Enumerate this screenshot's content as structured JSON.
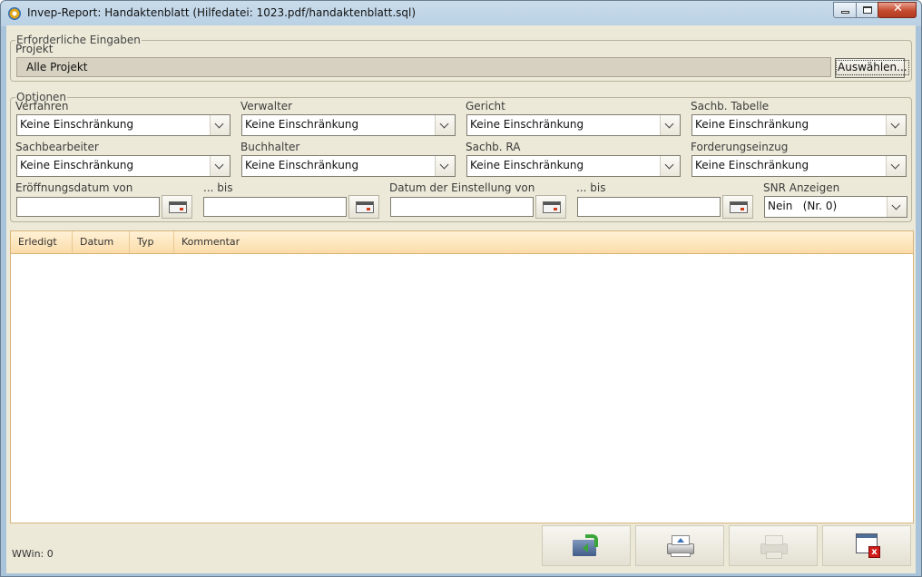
{
  "window": {
    "title": "Invep-Report: Handaktenblatt   (Hilfedatei: 1023.pdf/handaktenblatt.sql)"
  },
  "required": {
    "legend": "Erforderliche Eingaben",
    "projekt_label": "Projekt",
    "projekt_value": "Alle Projekt",
    "select_button": "Auswählen..."
  },
  "options": {
    "legend": "Optionen",
    "combos": [
      {
        "label": "Verfahren",
        "value": "Keine Einschränkung"
      },
      {
        "label": "Verwalter",
        "value": "Keine Einschränkung"
      },
      {
        "label": "Gericht",
        "value": "Keine Einschränkung"
      },
      {
        "label": "Sachb. Tabelle",
        "value": "Keine Einschränkung"
      },
      {
        "label": "Sachbearbeiter",
        "value": "Keine Einschränkung"
      },
      {
        "label": "Buchhalter",
        "value": "Keine Einschränkung"
      },
      {
        "label": "Sachb. RA",
        "value": "Keine Einschränkung"
      },
      {
        "label": "Forderungseinzug",
        "value": "Keine Einschränkung"
      }
    ],
    "dates": [
      {
        "label": "Eröffnungsdatum von",
        "value": ""
      },
      {
        "label": "... bis",
        "value": ""
      },
      {
        "label": "Datum der Einstellung von",
        "value": ""
      },
      {
        "label": "... bis",
        "value": ""
      }
    ],
    "snr": {
      "label": "SNR Anzeigen",
      "value": "Nein   (Nr. 0)"
    }
  },
  "table": {
    "columns": [
      "Erledigt",
      "Datum",
      "Typ",
      "Kommentar"
    ],
    "rows": []
  },
  "status": "WWin: 0",
  "toolbar": {
    "icons": [
      "folder-export-icon",
      "printer-icon",
      "printer-disabled-icon",
      "window-close-icon"
    ]
  },
  "colors": {
    "table_header": "#fbdca9",
    "table_border": "#d8b47a",
    "client_bg": "#ece9d8",
    "close_button": "#c44b2f"
  }
}
